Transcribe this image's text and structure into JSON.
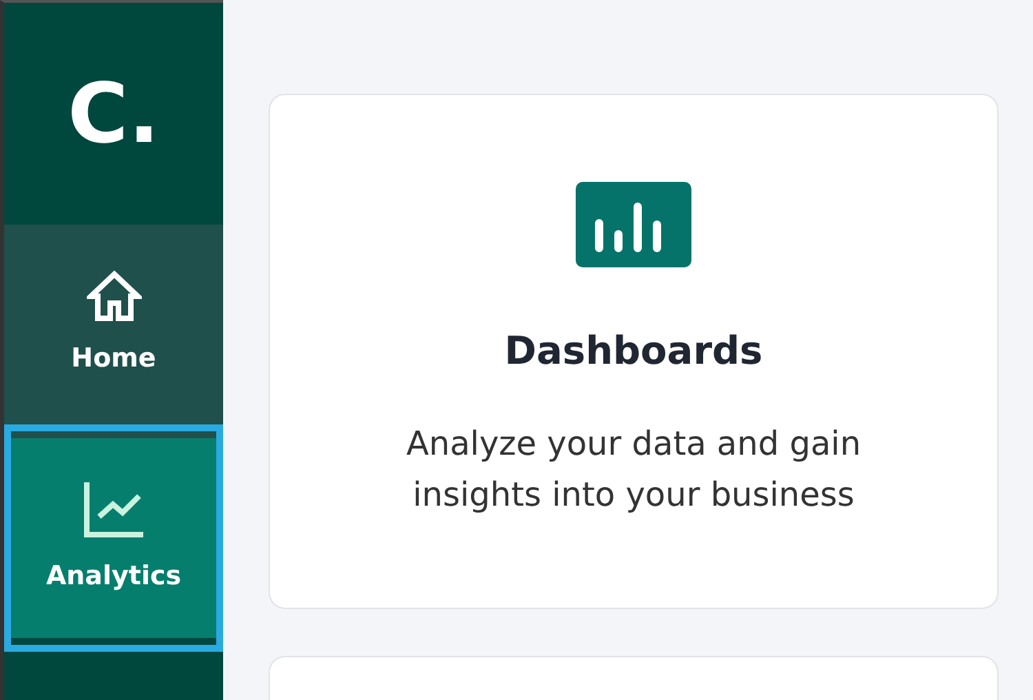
{
  "sidebar": {
    "logo": "C.",
    "items": [
      {
        "kind": "home",
        "label": "Home",
        "selected": false,
        "focused": false
      },
      {
        "kind": "analytics",
        "label": "Analytics",
        "selected": true,
        "focused": true
      }
    ]
  },
  "cards": [
    {
      "kind": "dashboards",
      "title": "Dashboards",
      "description": "Analyze your data and gain insights into your business"
    },
    {
      "kind": "blank"
    }
  ]
}
